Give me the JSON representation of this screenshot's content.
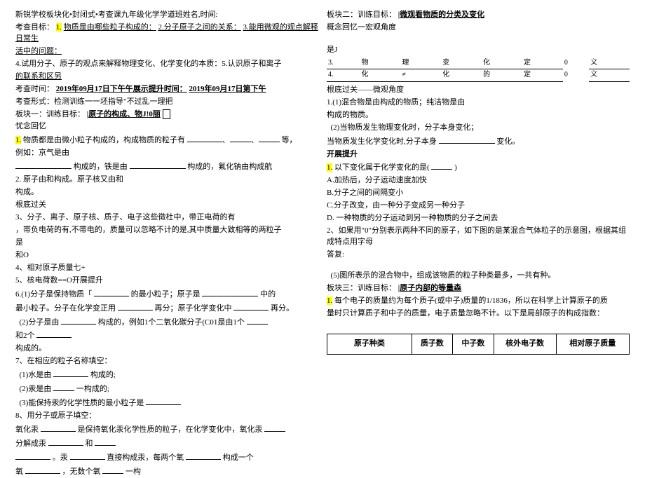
{
  "left": {
    "header": "新锐学校板块化•封闭式•考查课九年级化学学道班姓名,时间:",
    "kcmb": "考查目标：",
    "t1_num": "1.",
    "t1": "物质是由哪些粒子构成的：",
    "t2": "2.分子原子之间的关系：",
    "t3": "3.能用微观的观点解释日常生",
    "t3b": "活中的问题：",
    "t4": "4.试用分子、原子的观点来解释物理变化、化学变化的本质：5.认识原子和离子",
    "t4b": "的联系和区另",
    "kcsj": "考查时间：",
    "date1": "2019年09月17日下午午展示提升时间：",
    "date2": "2019年09月17日第下午",
    "kcxs": "考查形式：检测训练一一坯指导\"不过乱一理把",
    "bk1_lbl": "板块一：训练目标：",
    "bk1_tar": "原子的构成、物J!0丽",
    "gnhy": "忧念回忆",
    "li1_num": "1.",
    "li1": "物质都是由微小粒子构成的，构成物质的粒子有",
    "li1_deng": "等，",
    "li1b": "例如：京气是由",
    "li1c": "构成的，铁是由",
    "li1d": "构成的，氟化钠由构成航",
    "li2": "2. 原子由和构成。原子核又由和",
    "li2b": "构成。",
    "gdgk": "根底过关",
    "q3": "3、分子、离子、原子核、质子、电子这些徵杜中，带正电荷的有",
    "q3b": "，帯负电荷的有,不帯电的，质量可以忽略不计的是,其中质量大致相等的两粒子",
    "q3c": "是",
    "q3d": "和O",
    "q4": "4、相对原子质量七+",
    "q5": "5、核电荷数==O开展提升",
    "q6": "6.(1)分子是保持物质「",
    "q6b": "的最小粒子；原子是",
    "q6c": "中的",
    "q6d": "最小粒子。分子在化学变正用",
    "q6e": "再分；原子化学变化中",
    "q6f": "再分。",
    "q6_2": "(2)分子是由",
    "q6_2b": "构成的，例如1个二氧化碳分子(C01是由1个",
    "q6_2c": "和2个",
    "q6_2d": "构成的。",
    "q7": "7、在相应的粒子名称填空：",
    "q7_1": "(1)水是由",
    "q7_1b": "构成的;",
    "q7_2": "(2)汞是由",
    "q7_2b": "一构成的;",
    "q7_3": "(3)能保持汞的化学性质的最小粒子是",
    "q8": "8、用分子或原子填空：",
    "q8a": "氧化汞",
    "q8b": "是保持氧化汞化学性质的粒子，在化学变化中，氧化汞",
    "q8c": "分解成汞",
    "q8d": "和",
    "q8e": "。汞",
    "q8f": "直接构成汞，每两个氧",
    "q8g": "构成一个",
    "q8h": "氧",
    "q8i": "，无数个氧",
    "q8j": "一构"
  },
  "right": {
    "bk2_lbl": "板块二：训练目标：",
    "bk2_tar": "微观看物质的分类及变化",
    "gnhy2": "概念回忆一宏观角度",
    "shi_j": "是J",
    "tbl_r1_c1": "3.",
    "tbl_r1_c2": "物",
    "tbl_r1_c3": "理",
    "tbl_r1_c4": "变",
    "tbl_r1_c5": "化",
    "tbl_r1_c6": "定",
    "tbl_r1_c7": "0",
    "tbl_r1_c8": "义",
    "tbl_r2_c1": "4.",
    "tbl_r2_c2": "化",
    "tbl_r2_c3": "≠",
    "tbl_r2_c4": "化",
    "tbl_r2_c5": "的",
    "tbl_r2_c6": "定",
    "tbl_r2_c7": "0",
    "tbl_r2_c8": "义",
    "gdgk2": "根底过关——微观角度",
    "r1": "1.(1)混合物是由构成的物质；纯洁物是由",
    "r1b": "构成的物质。",
    "r2": "(2)当物质发生物理变化时，分子本身变化；",
    "r2b": "当物质发生化学变化时,分子本身",
    "r2c": "变化。",
    "kzts": "开展提升",
    "r3_num": "1.",
    "r3": "以下变化属于化学变化的是(",
    "r3b": ")",
    "ra": "A.加热后，分子运动速度加快",
    "rb": "B.分子之间的间隔变小",
    "rc": "C.分子改变，由一种分子变成另一种分子",
    "rd": "D. 一种物质的分子运动到另一种物质的分子之间去",
    "r4": "2、如果用\"0\"分别表示两种不同的原子，如下图的是某混合气体粒子的示意图，根据其组成特点用字母",
    "r4b": "答复:",
    "r5": "(5)图所表示的混合物中，组成该物质的粒子种类最多，一共有种。",
    "bk3_lbl": "板块三：训练目标：",
    "bk3_tar": "原子内部的等量森",
    "r6_num": "1.",
    "r6": "每个电子的质量约为每个质子(或中子)质量的1/1836，所以在科学上计算原子的质",
    "r6b": "量时只计算质子和中子的质量，电子质量忽略不计。以下是局部原子的构成指数：",
    "bt_h1": "原子种类",
    "bt_h2": "质子数",
    "bt_h3": "中子数",
    "bt_h4": "核外电子数",
    "bt_h5": "相对原子质量"
  }
}
